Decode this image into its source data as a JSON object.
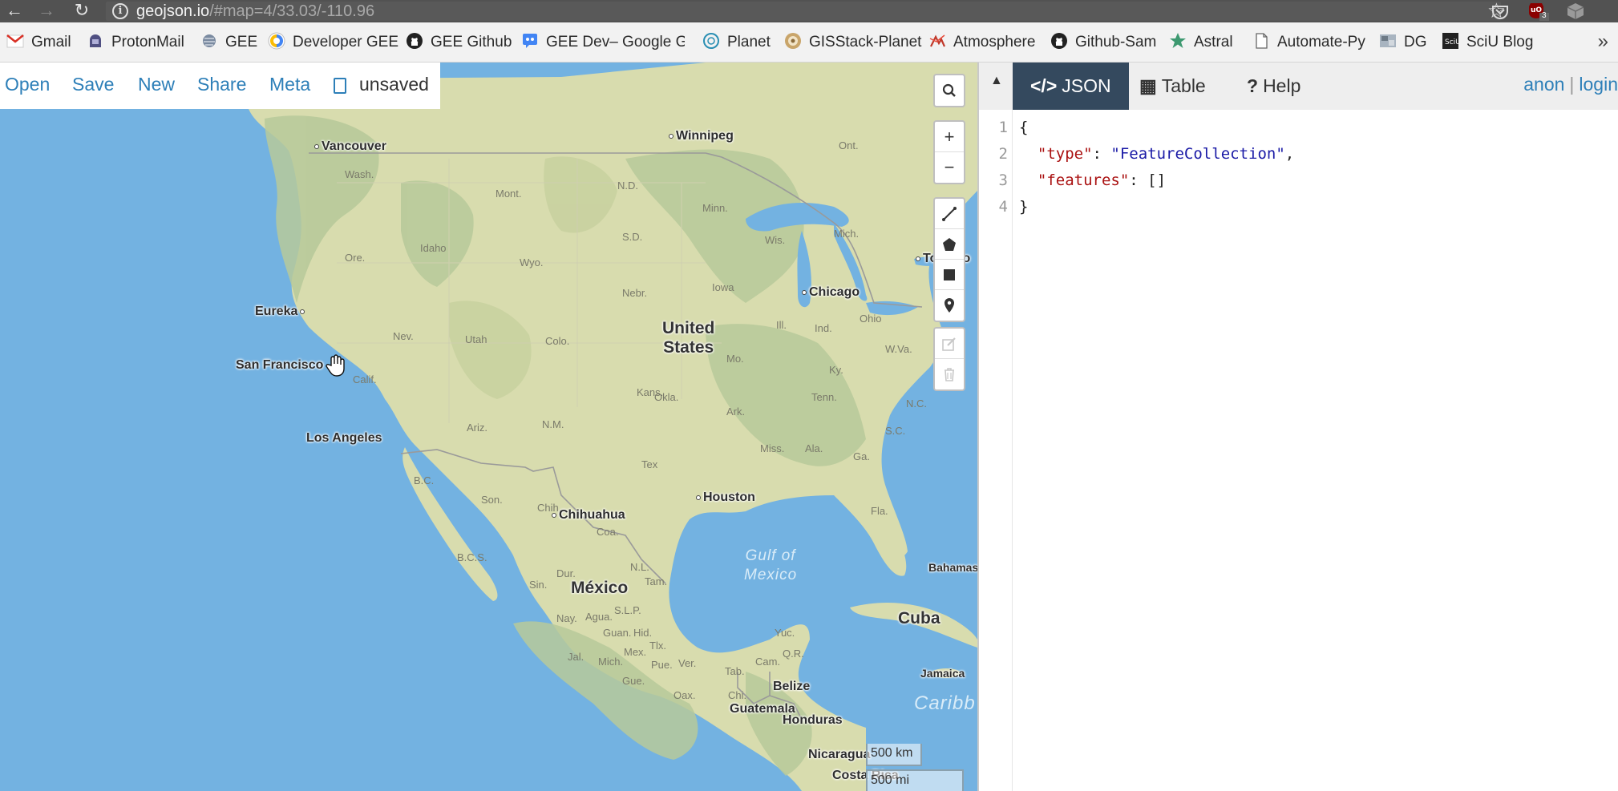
{
  "browser": {
    "url_host": "geojson.io",
    "url_path": "/#map=4/33.03/-110.96",
    "ext_badge": "3"
  },
  "bookmarks": [
    {
      "label": "Gmail"
    },
    {
      "label": "ProtonMail"
    },
    {
      "label": "GEE"
    },
    {
      "label": "Developer GEE"
    },
    {
      "label": "GEE Github"
    },
    {
      "label": "GEE Dev– Google Gro"
    },
    {
      "label": "Planet"
    },
    {
      "label": "GISStack-Planet"
    },
    {
      "label": "Atmosphere"
    },
    {
      "label": "Github-Sam"
    },
    {
      "label": "Astral"
    },
    {
      "label": "Automate-Py"
    },
    {
      "label": "DG"
    },
    {
      "label": "SciU Blog"
    }
  ],
  "toolbar": {
    "open": "Open",
    "save": "Save",
    "new": "New",
    "share": "Share",
    "meta": "Meta",
    "status": "unsaved"
  },
  "map": {
    "cities": {
      "vancouver": "Vancouver",
      "winnipeg": "Winnipeg",
      "eureka": "Eureka",
      "san_francisco": "San Francisco",
      "los_angeles": "Los Angeles",
      "chicago": "Chicago",
      "toronto": "Toronto",
      "houston": "Houston",
      "chihuahua": "Chihuahua",
      "mexico": "México",
      "cuba": "Cuba",
      "belize": "Belize",
      "guatemala": "Guatemala",
      "honduras": "Honduras",
      "nicaragua": "Nicaragua",
      "costa_rica": "Costa Rica",
      "jamaica": "Jamaica",
      "bahamas": "Bahamas",
      "united_states_1": "United",
      "united_states_2": "States",
      "gulf_1": "Gulf of",
      "gulf_2": "Mexico",
      "caribbean": "Caribb"
    },
    "states": [
      "Wash.",
      "Mont.",
      "N.D.",
      "Minn.",
      "Ont.",
      "Ore.",
      "Idaho",
      "Wyo.",
      "S.D.",
      "Wis.",
      "Mich.",
      "Nebr.",
      "Iowa",
      "Nev.",
      "Utah",
      "Colo.",
      "Ill.",
      "Ind.",
      "Ohio",
      "Calif.",
      "Kans.",
      "Mo.",
      "Ky.",
      "W.Va.",
      "Okla.",
      "Tenn.",
      "N.C.",
      "Ariz.",
      "N.M.",
      "Ark.",
      "S.C.",
      "Miss.",
      "Ala.",
      "Ga.",
      "Tex",
      "B.C.",
      "Son.",
      "Chih.",
      "Coa.",
      "N.L.",
      "Tam.",
      "B.C.S.",
      "Sin.",
      "Dur.",
      "Fla.",
      "Yuc.",
      "Q.R.",
      "Tab.",
      "Nay.",
      "Agua.",
      "S.L.P.",
      "Guan.",
      "Hid.",
      "Jal.",
      "Mich.",
      "Mex.",
      "Tlx.",
      "Pue.",
      "Ver.",
      "Gue.",
      "Oax.",
      "Chi.",
      "Cam."
    ],
    "scale_km": "500 km",
    "scale_mi": "500 mi"
  },
  "panel": {
    "tabs": [
      {
        "icon": "</>",
        "label": "JSON"
      },
      {
        "icon": "▦",
        "label": "Table"
      },
      {
        "icon": "?",
        "label": "Help"
      }
    ],
    "auth_anon": "anon",
    "auth_sep": "|",
    "auth_login": "login"
  },
  "editor": {
    "lines": [
      "1",
      "2",
      "3",
      "4"
    ],
    "open_brace": "{",
    "type_key": "\"type\"",
    "type_val": "\"FeatureCollection\"",
    "features_key": "\"features\"",
    "features_val": "[]",
    "close_brace": "}"
  },
  "colors": {
    "water": "#73b2e1",
    "land": "#d9dcb0",
    "accent": "#2d7fb8",
    "active_tab": "#34495e"
  }
}
